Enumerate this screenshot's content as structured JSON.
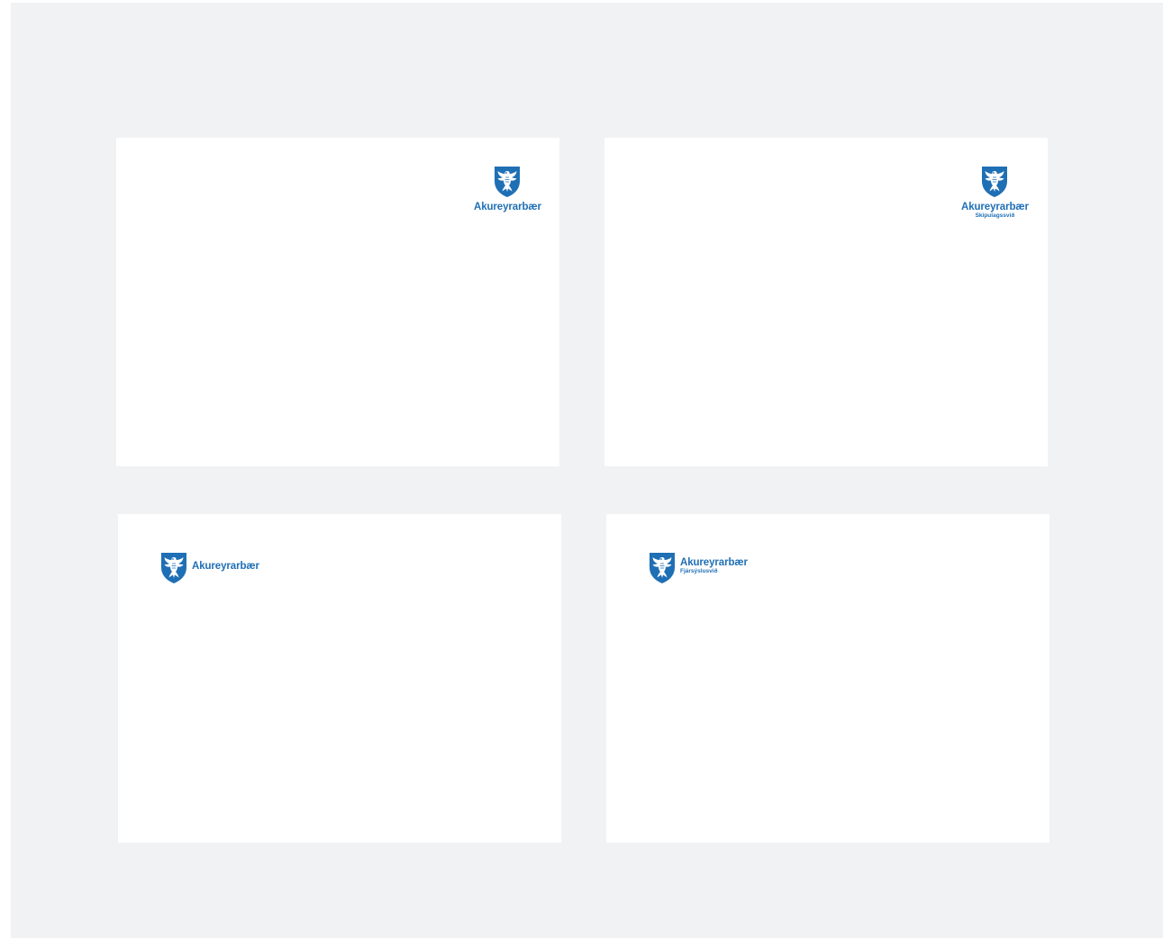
{
  "brand": {
    "color": "#1f6fb5",
    "background": "#f1f2f4",
    "card_background": "#ffffff"
  },
  "cards": [
    {
      "logo_layout": "stacked",
      "logo_icon": "coat-of-arms-icon",
      "name": "Akureyrarbær",
      "subtitle": ""
    },
    {
      "logo_layout": "stacked",
      "logo_icon": "coat-of-arms-icon",
      "name": "Akureyrarbær",
      "subtitle": "Skipulagssvið"
    },
    {
      "logo_layout": "horizontal",
      "logo_icon": "coat-of-arms-icon",
      "name": "Akureyrarbær",
      "subtitle": ""
    },
    {
      "logo_layout": "horizontal",
      "logo_icon": "coat-of-arms-icon",
      "name": "Akureyrarbær",
      "subtitle": "Fjársýslusvið"
    }
  ]
}
